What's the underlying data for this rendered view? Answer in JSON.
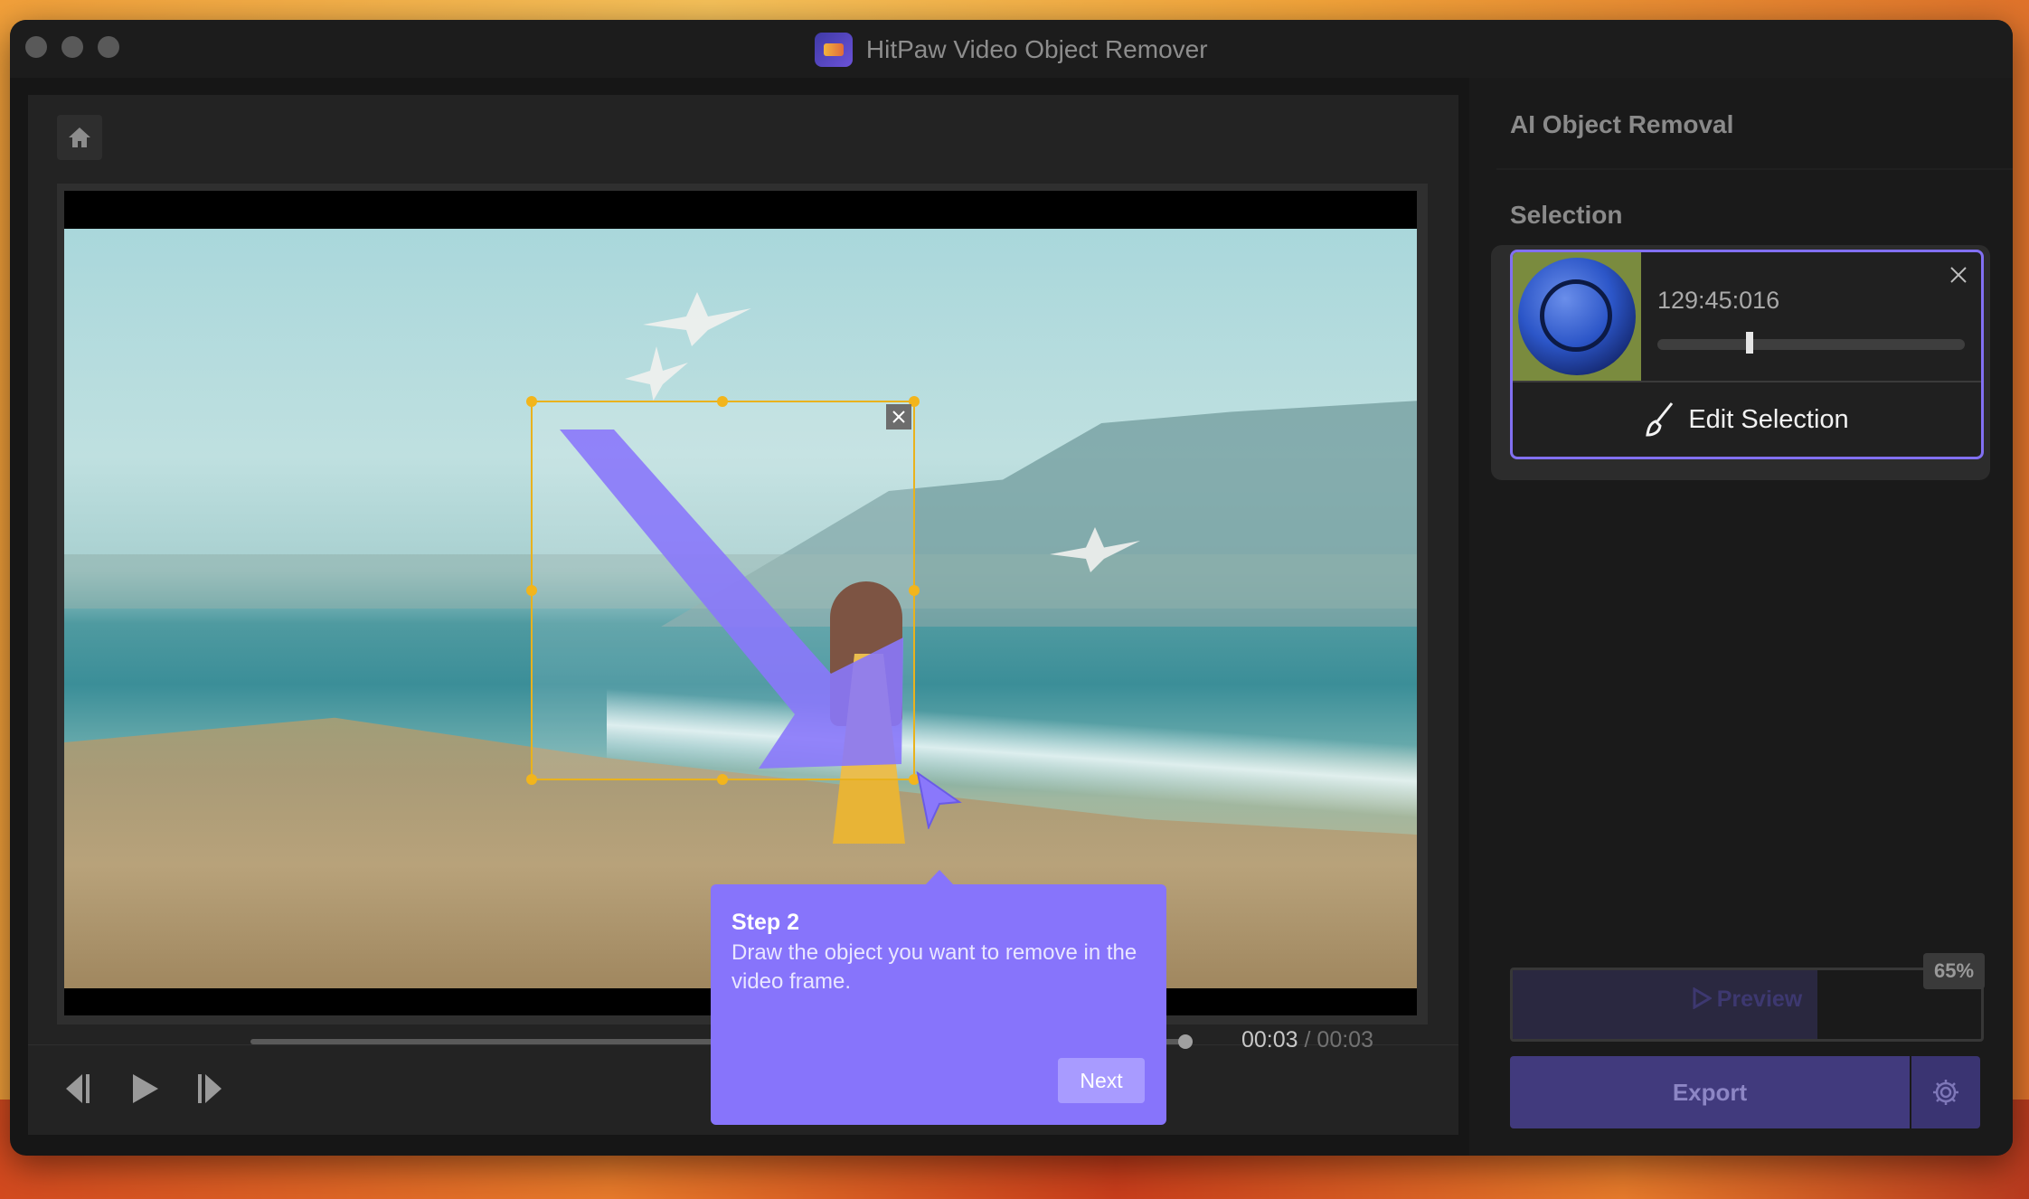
{
  "window": {
    "title": "HitPaw Video Object Remover"
  },
  "player": {
    "current_time": "00:03",
    "separator": "/",
    "duration": "00:03",
    "progress": 1.0
  },
  "tooltip": {
    "title": "Step 2",
    "body": "Draw the object you want to remove in the video frame.",
    "next_label": "Next"
  },
  "panel": {
    "title": "AI Object Removal",
    "section_label": "Selection",
    "selection_card": {
      "time": "129:45:016",
      "edit_label": "Edit Selection",
      "position": 0.3
    },
    "preview": {
      "label": "Preview",
      "percent_label": "65%",
      "progress": 0.65
    },
    "export_label": "Export"
  },
  "icons": [
    "home-icon",
    "close-icon",
    "arrow-icon",
    "cursor-icon",
    "step-back-icon",
    "play-icon",
    "step-forward-icon",
    "brush-icon",
    "gear-icon"
  ],
  "colors": {
    "accent": "#8774fb",
    "selection": "#e9b21d",
    "card_border": "#8270f2"
  }
}
